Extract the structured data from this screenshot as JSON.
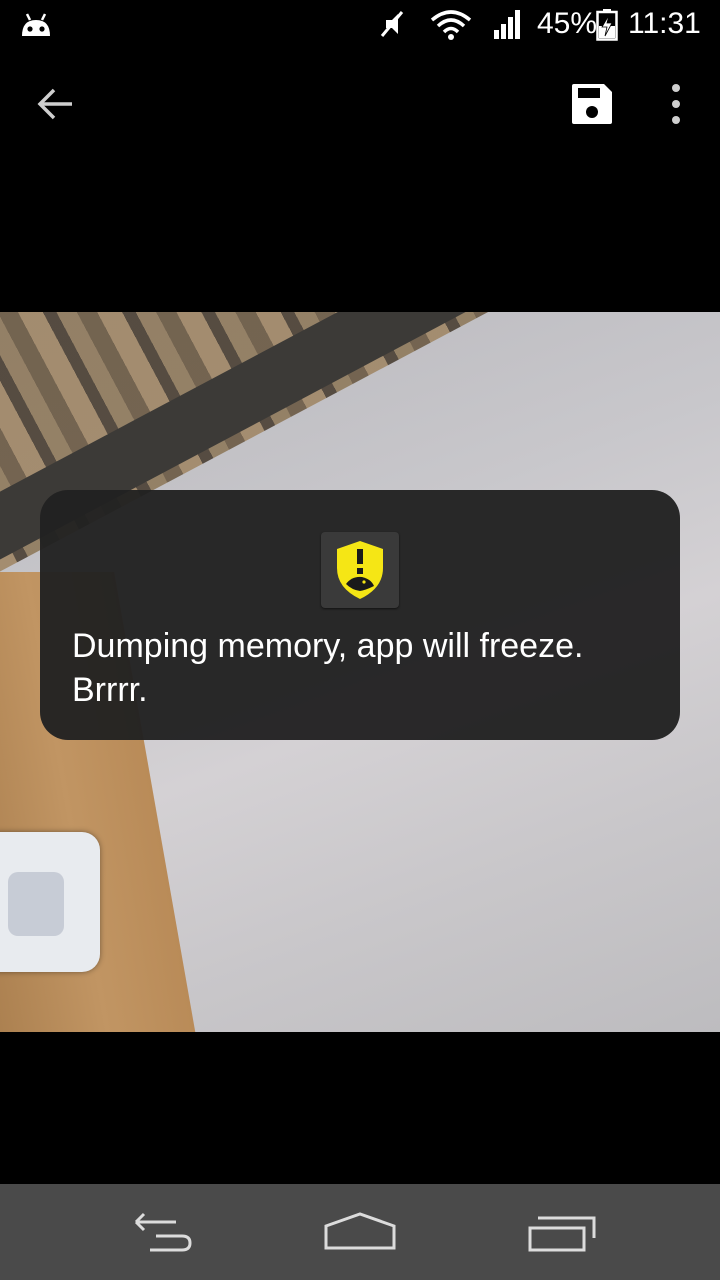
{
  "status_bar": {
    "battery_percent": "45%",
    "time": "11:31",
    "icons": [
      "android-icon",
      "mute-icon",
      "wifi-icon",
      "signal-icon",
      "battery-charging-icon"
    ]
  },
  "action_bar": {
    "icons": [
      "back-arrow-icon",
      "save-icon",
      "more-vert-icon"
    ]
  },
  "toast": {
    "icon": "shield-warning-icon",
    "icon_color": "#f5e615",
    "message": "Dumping memory, app will freeze. Brrrr."
  },
  "nav_bar": {
    "icons": [
      "nav-back-icon",
      "nav-home-icon",
      "nav-recents-icon"
    ],
    "background": "#4a4a4a"
  }
}
